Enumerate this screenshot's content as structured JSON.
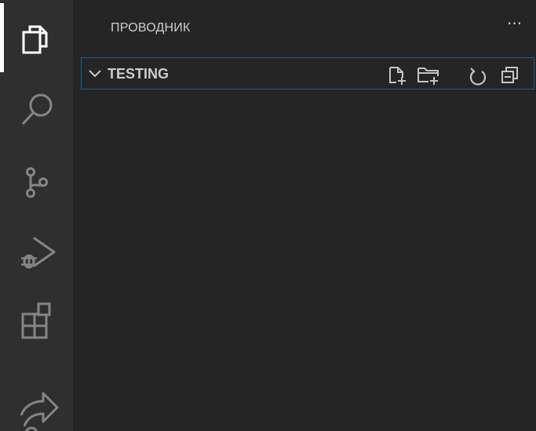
{
  "sidebar": {
    "title": "ПРОВОДНИК",
    "more_actions_label": "···"
  },
  "section": {
    "title": "TESTING"
  },
  "icons": {
    "activity_bar": [
      "explorer-icon",
      "search-icon",
      "source-control-icon",
      "run-debug-icon",
      "extensions-icon",
      "live-share-icon"
    ],
    "section_actions": [
      "new-file-icon",
      "new-folder-icon",
      "refresh-icon",
      "collapse-all-icon"
    ]
  },
  "colors": {
    "activity_bar": "#2f2f2f",
    "sidebar": "#252526",
    "text": "#cccccc",
    "focus_border": "#0e639c"
  }
}
